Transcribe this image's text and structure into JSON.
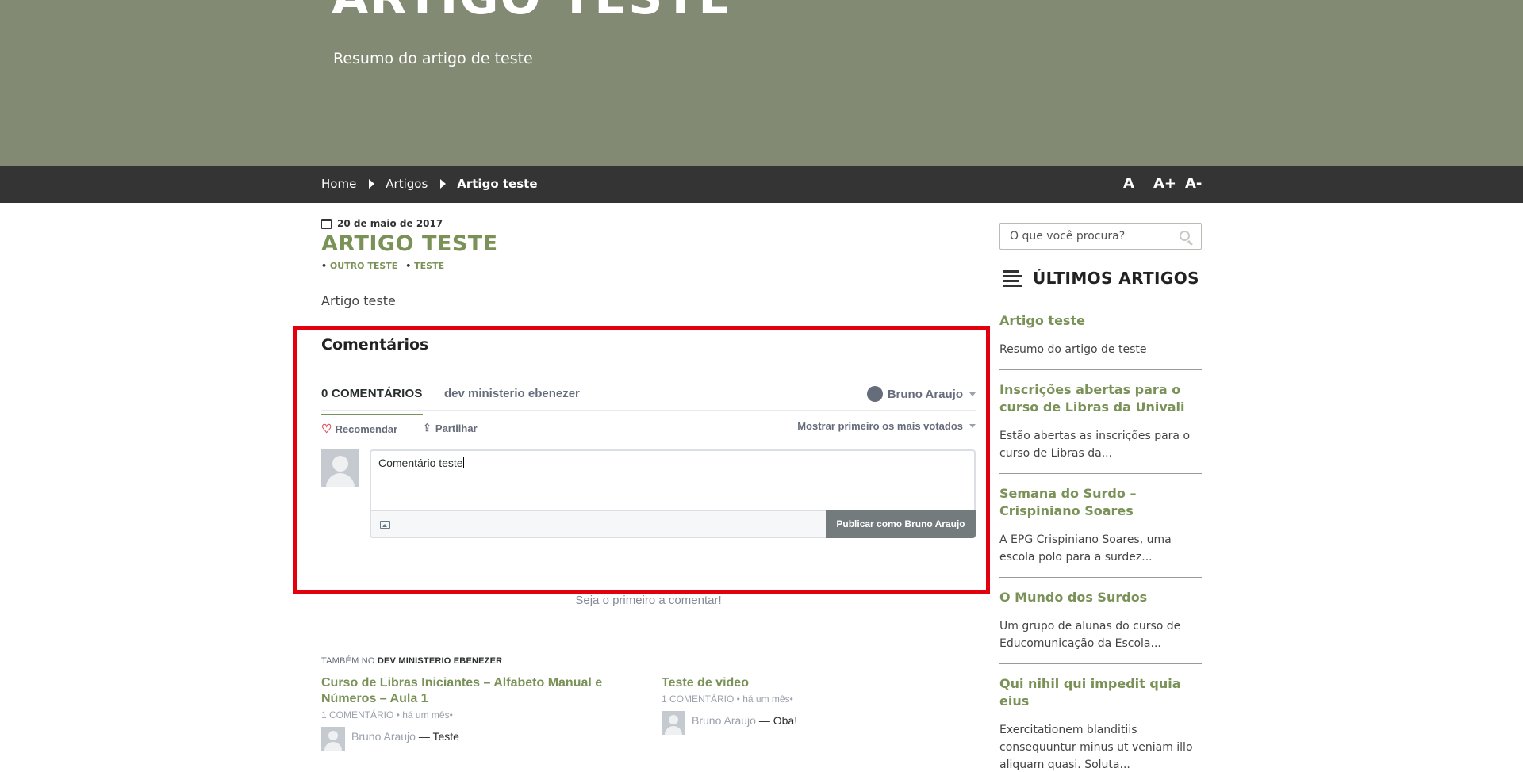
{
  "hero": {
    "title": "ARTIGO TESTE",
    "subtitle": "Resumo do artigo de teste"
  },
  "breadcrumb": {
    "home": "Home",
    "section": "Artigos",
    "current": "Artigo teste"
  },
  "font_controls": {
    "normal": "A",
    "increase": "A+",
    "decrease": "A-"
  },
  "post": {
    "date": "20 de maio de 2017",
    "title": "ARTIGO TESTE",
    "tags": [
      "OUTRO TESTE",
      "TESTE"
    ],
    "body": "Artigo teste"
  },
  "comments": {
    "heading": "Comentários",
    "count_tab": "0 COMENTÁRIOS",
    "community_tab": "dev ministerio ebenezer",
    "user": "Bruno Araujo",
    "recommend": "Recomendar",
    "share": "Partilhar",
    "sort": "Mostrar primeiro os mais votados",
    "draft": "Comentário teste",
    "publish_button": "Publicar como Bruno Araujo",
    "empty_message": "Seja o primeiro a comentar!"
  },
  "also_on": {
    "prefix": "TAMBÉM NO",
    "site": "DEV MINISTERIO EBENEZER",
    "items": [
      {
        "title": "Curso de Libras Iniciantes – Alfabeto Manual e Números – Aula 1",
        "meta": "1 COMENTÁRIO • há um mês•",
        "author": "Bruno Araujo",
        "snippet": "— Teste"
      },
      {
        "title": "Teste de video",
        "meta": "1 COMENTÁRIO • há um mês•",
        "author": "Bruno Araujo",
        "snippet": "— Oba!"
      }
    ]
  },
  "sidebar": {
    "search_placeholder": "O que você procura?",
    "widget_title": "ÚLTIMOS ARTIGOS",
    "articles": [
      {
        "title": "Artigo teste",
        "excerpt": "Resumo do artigo de teste"
      },
      {
        "title": "Inscrições abertas para o curso de Libras da Univali",
        "excerpt": "Estão abertas as inscrições para o curso de Libras da..."
      },
      {
        "title": "Semana do Surdo – Crispiniano Soares",
        "excerpt": "A EPG Crispiniano Soares, uma escola polo para a surdez..."
      },
      {
        "title": "O Mundo dos Surdos",
        "excerpt": "Um grupo de alunas do curso de Educomunicação da Escola..."
      },
      {
        "title": "Qui nihil qui impedit quia eius",
        "excerpt": "Exercitationem blanditiis consequuntur minus ut veniam illo aliquam quasi. Soluta..."
      }
    ]
  },
  "colors": {
    "hero": "#838a74",
    "accent": "#7a9157",
    "breadcrumb_bar": "#343434",
    "highlight": "#e2000f"
  }
}
